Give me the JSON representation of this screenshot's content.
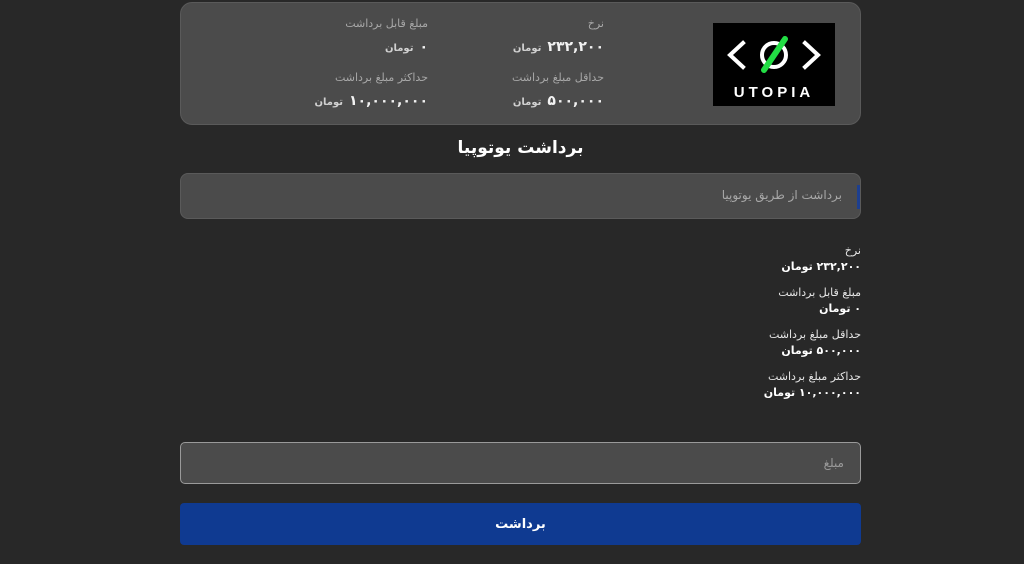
{
  "card": {
    "logo_text": "UTOPIA",
    "rate": {
      "label": "نرخ",
      "value": "۲۳۲,۲۰۰",
      "unit": "تومان"
    },
    "available": {
      "label": "مبلغ قابل برداشت",
      "value": "۰",
      "unit": "تومان"
    },
    "min": {
      "label": "حداقل مبلغ برداشت",
      "value": "۵۰۰,۰۰۰",
      "unit": "تومان"
    },
    "max": {
      "label": "حداکثر مبلغ برداشت",
      "value": "۱۰,۰۰۰,۰۰۰",
      "unit": "تومان"
    }
  },
  "title": "برداشت یوتوپیا",
  "method_select": {
    "text": "برداشت از طریق یوتوپیا"
  },
  "details": [
    {
      "label": "نرخ",
      "value": "۲۳۲,۲۰۰ تومان"
    },
    {
      "label": "مبلغ قابل برداشت",
      "value": "۰ تومان"
    },
    {
      "label": "حداقل مبلغ برداشت",
      "value": "۵۰۰,۰۰۰ تومان"
    },
    {
      "label": "حداکثر مبلغ برداشت",
      "value": "۱۰,۰۰۰,۰۰۰ تومان"
    }
  ],
  "amount_input": {
    "placeholder": "مبلغ",
    "value": ""
  },
  "submit_label": "برداشت",
  "colors": {
    "accent": "#0f3a91",
    "logo_green": "#22dd44",
    "card_bg": "#4b4b4b",
    "page_bg": "#282828"
  }
}
